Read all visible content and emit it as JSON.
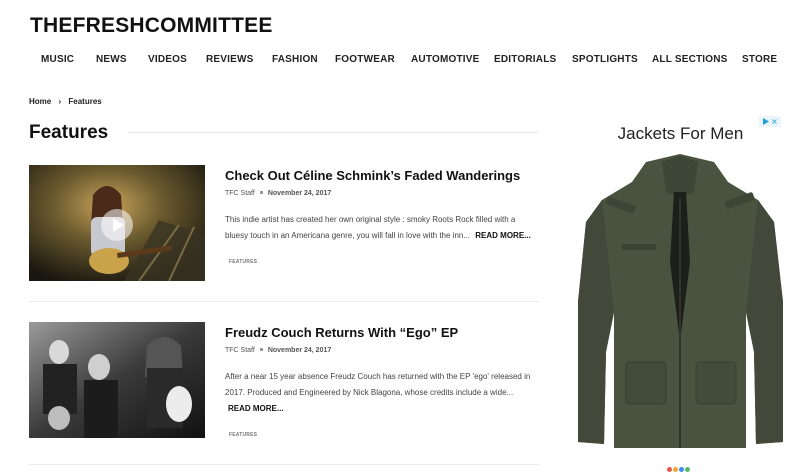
{
  "site": {
    "logo": "THEFRESHCOMMITTEE"
  },
  "nav": {
    "items": [
      {
        "label": "MUSIC"
      },
      {
        "label": "NEWS"
      },
      {
        "label": "VIDEOS"
      },
      {
        "label": "REVIEWS"
      },
      {
        "label": "FASHION"
      },
      {
        "label": "FOOTWEAR"
      },
      {
        "label": "AUTOMOTIVE"
      },
      {
        "label": "EDITORIALS"
      },
      {
        "label": "SPOTLIGHTS"
      },
      {
        "label": "ALL SECTIONS"
      },
      {
        "label": "STORE"
      }
    ]
  },
  "breadcrumb": {
    "home": "Home",
    "separator": "›",
    "current": "Features"
  },
  "page": {
    "title": "Features"
  },
  "articles": [
    {
      "title": "Check Out Céline Schmink’s Faded Wanderings",
      "author": "TFC Staff",
      "date": "November 24, 2017",
      "excerpt": "This indie artist has created her own original style : smoky Roots Rock filled with a bluesy touch in an Americana genre, you will fall in love with the inn...",
      "read_more": "READ MORE...",
      "tag": "FEATURES",
      "has_video": true
    },
    {
      "title": "Freudz Couch Returns With “Ego” EP",
      "author": "TFC Staff",
      "date": "November 24, 2017",
      "excerpt": "After a near 15 year absence Freudz Couch has returned with the EP 'ego' released in 2017. Produced and Engineered by Nick Blagona, whose credits include a wide...",
      "read_more": "READ MORE...",
      "tag": "FEATURES",
      "has_video": false
    }
  ],
  "ad": {
    "title": "Jackets For Men",
    "icon": "adchoices-icon",
    "product_color": "#4a5340",
    "dot_colors": [
      "#e6574b",
      "#f3a43b",
      "#3c8ef0",
      "#5ab86a"
    ]
  }
}
